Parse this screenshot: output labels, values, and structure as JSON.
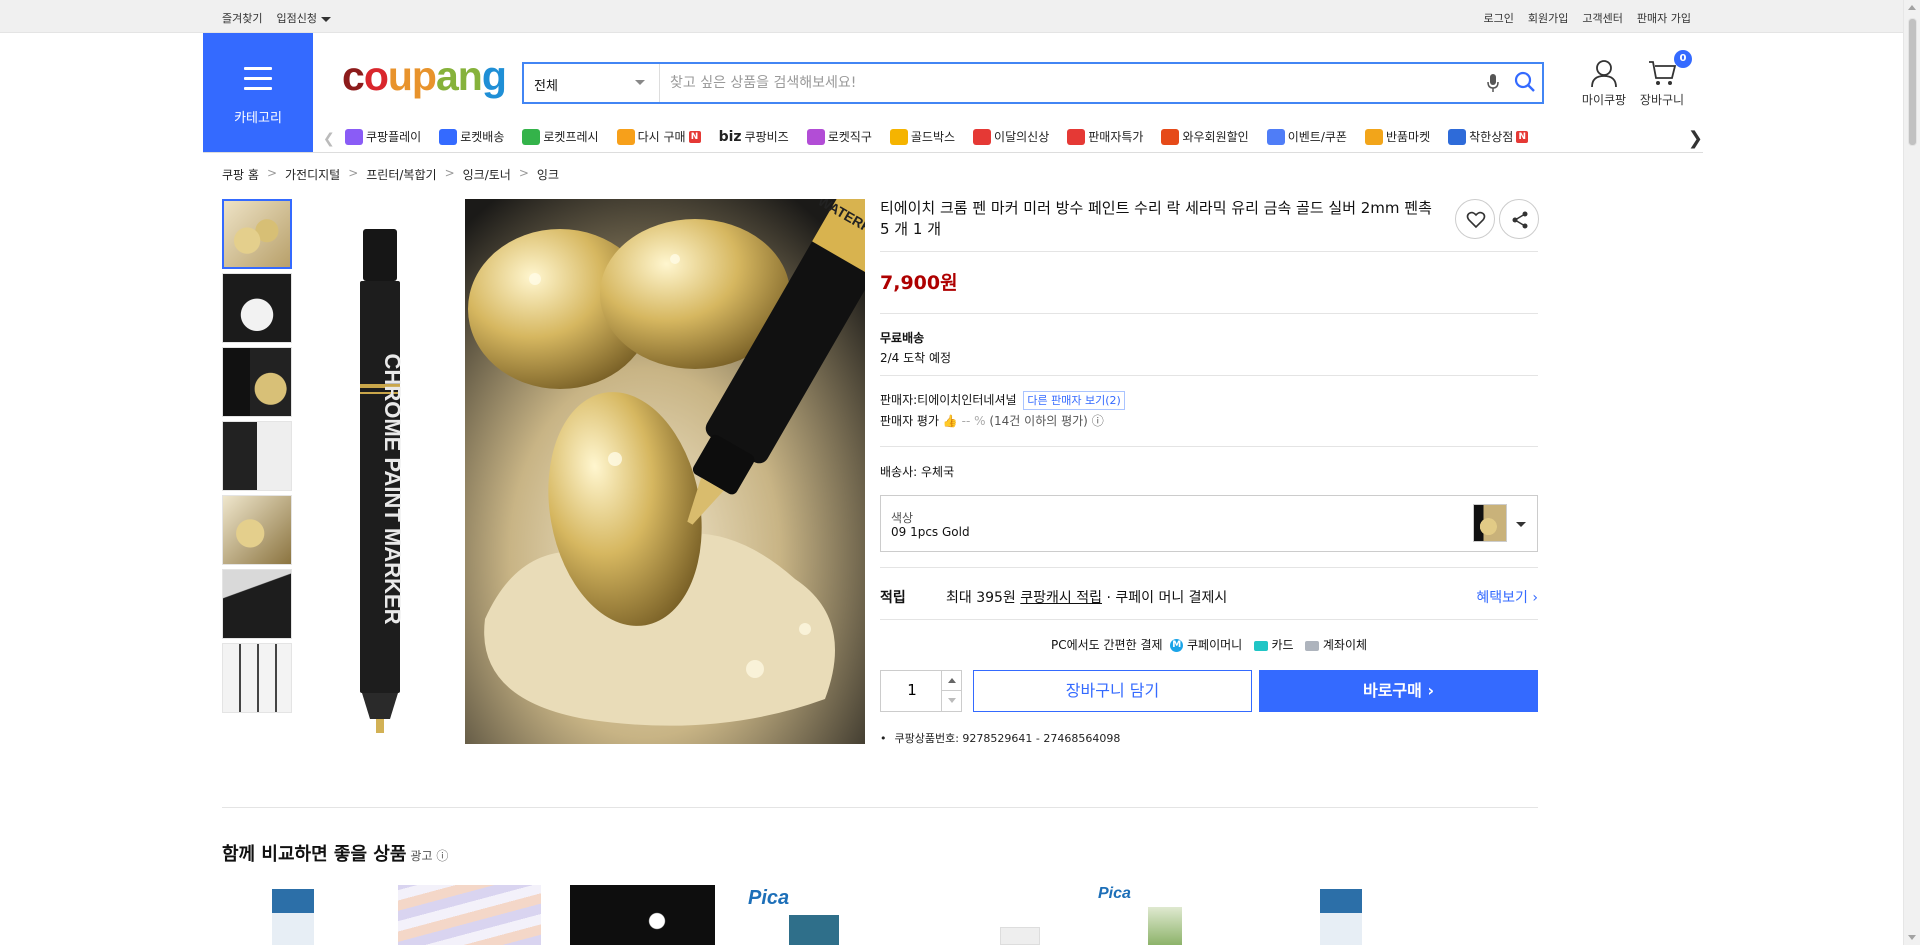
{
  "topbar": {
    "left": [
      "즐겨찾기",
      "입점신청"
    ],
    "right": [
      "로그인",
      "회원가입",
      "고객센터",
      "판매자 가입"
    ]
  },
  "header": {
    "category_label": "카테고리",
    "logo_letters": [
      "c",
      "o",
      "u",
      "p",
      "a",
      "n",
      "g"
    ],
    "search": {
      "category": "전체",
      "placeholder": "찾고 싶은 상품을 검색해보세요!"
    },
    "mycoupang": "마이쿠팡",
    "cart": {
      "label": "장바구니",
      "count": "0"
    }
  },
  "nav": [
    {
      "label": "쿠팡플레이",
      "icon": "coupang-play-icon",
      "color": "#8a5cf6"
    },
    {
      "label": "로켓배송",
      "icon": "rocket-icon",
      "color": "#346aff"
    },
    {
      "label": "로켓프레시",
      "icon": "rocket-fresh-icon",
      "color": "#34b34a"
    },
    {
      "label": "다시 구매",
      "icon": "rebuy-icon",
      "color": "#f7a01a",
      "badge": "N"
    },
    {
      "label": "쿠팡비즈",
      "icon": "biz-icon",
      "prefix": "biz",
      "color": "#1f2a44"
    },
    {
      "label": "로켓직구",
      "icon": "rocket-global-icon",
      "color": "#b24dd6"
    },
    {
      "label": "골드박스",
      "icon": "goldbox-icon",
      "color": "#f5b400"
    },
    {
      "label": "이달의신상",
      "icon": "new-icon",
      "color": "#e53935"
    },
    {
      "label": "판매자특가",
      "icon": "seller-deal-icon",
      "color": "#e53935"
    },
    {
      "label": "와우회원할인",
      "icon": "wow-icon",
      "color": "#e64a19"
    },
    {
      "label": "이벤트/쿠폰",
      "icon": "event-icon",
      "color": "#4f7df7"
    },
    {
      "label": "반품마켓",
      "icon": "return-market-icon",
      "color": "#f2a51a"
    },
    {
      "label": "착한상점",
      "icon": "good-store-icon",
      "color": "#2e6bd9",
      "badge": "N"
    }
  ],
  "breadcrumb": [
    "쿠팡 홈",
    "가전디지털",
    "프린터/복합기",
    "잉크/토너",
    "잉크"
  ],
  "product": {
    "title": "티에이치 크롬 펜 마커 미러 방수 페인트 수리 락 세라믹 유리 금속 골드 실버 2mm 펜촉 5 개 1 개",
    "price": "7,900원",
    "shipping_title": "무료배송",
    "arrival": "2/4 도착 예정",
    "seller_label": "판매자:",
    "seller_name": "티에이치인터네셔널",
    "other_sellers": "다른 판매자 보기(2)",
    "seller_rating_label": "판매자 평가",
    "seller_rating_value": "-- %",
    "seller_rating_note": "(14건 이하의 평가)",
    "carrier_label": "배송사:",
    "carrier": "우체국",
    "option_label": "색상",
    "option_value": "09 1pcs Gold",
    "reward_label": "적립",
    "reward_max": "최대 395원",
    "reward_link": "쿠팡캐시 적립",
    "reward_tail": "· 쿠페이 머니 결제시",
    "benefit": "혜택보기",
    "pay_title": "PC에서도 간편한 결제",
    "pay_money": "쿠페이머니",
    "pay_card": "카드",
    "pay_bank": "계좌이체",
    "quantity": "1",
    "add_to_cart": "장바구니 담기",
    "buy_now": "바로구매",
    "product_no": "쿠팡상품번호: 9278529641 - 27468564098",
    "pen_text": "CHROME PAINT MARKER",
    "photo_text": "WATERPROOF"
  },
  "compare": {
    "title": "함께 비교하면 좋을 상품",
    "ad": "광고",
    "brand": "Pica"
  },
  "colors": {
    "accent": "#346aff",
    "price": "#ae0000"
  }
}
